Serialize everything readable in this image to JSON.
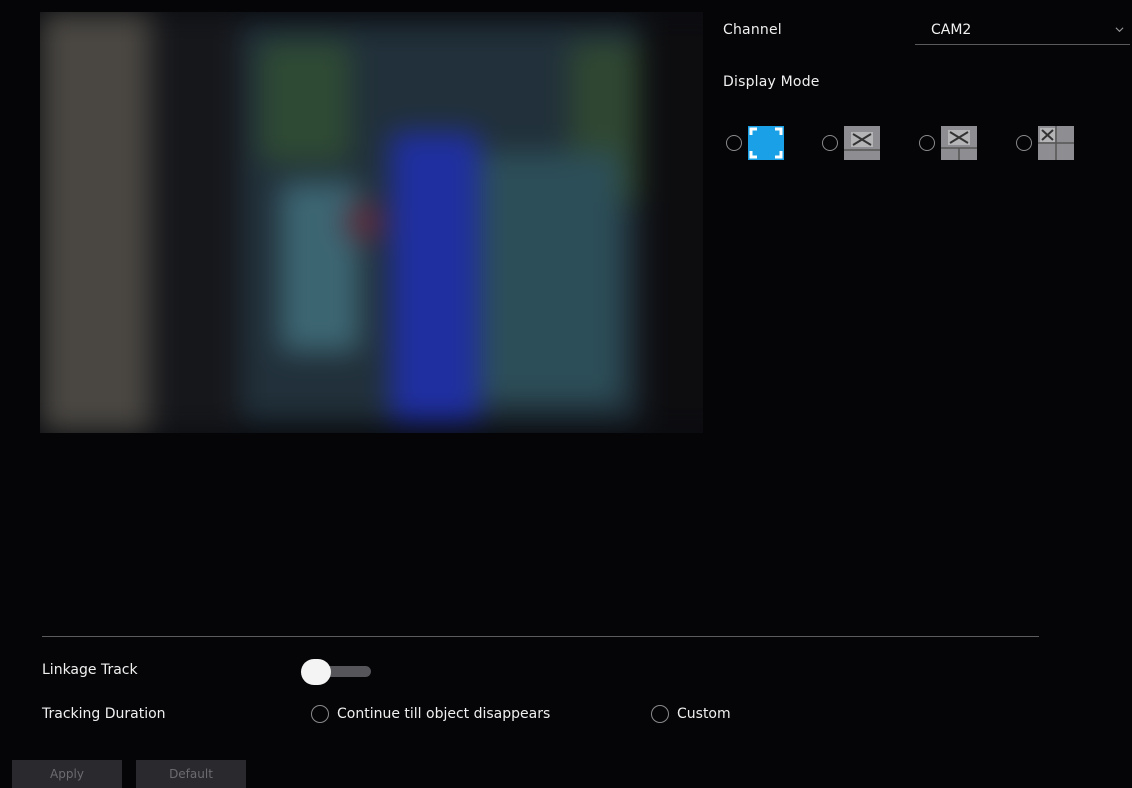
{
  "channel": {
    "label": "Channel",
    "value": "CAM2"
  },
  "display_mode": {
    "label": "Display Mode",
    "options": [
      {
        "icon": "fullscreen-icon",
        "selected": true
      },
      {
        "icon": "split-2-icon",
        "selected": false
      },
      {
        "icon": "split-3-icon",
        "selected": false
      },
      {
        "icon": "split-4-icon",
        "selected": false
      }
    ]
  },
  "linkage_track": {
    "label": "Linkage Track",
    "enabled": false
  },
  "tracking_duration": {
    "label": "Tracking Duration",
    "options": [
      "Continue till object disappears",
      "Custom"
    ]
  },
  "buttons": {
    "apply": "Apply",
    "default": "Default"
  },
  "colors": {
    "accent": "#19a0e6",
    "inactive_icon": "#8e8e92"
  }
}
